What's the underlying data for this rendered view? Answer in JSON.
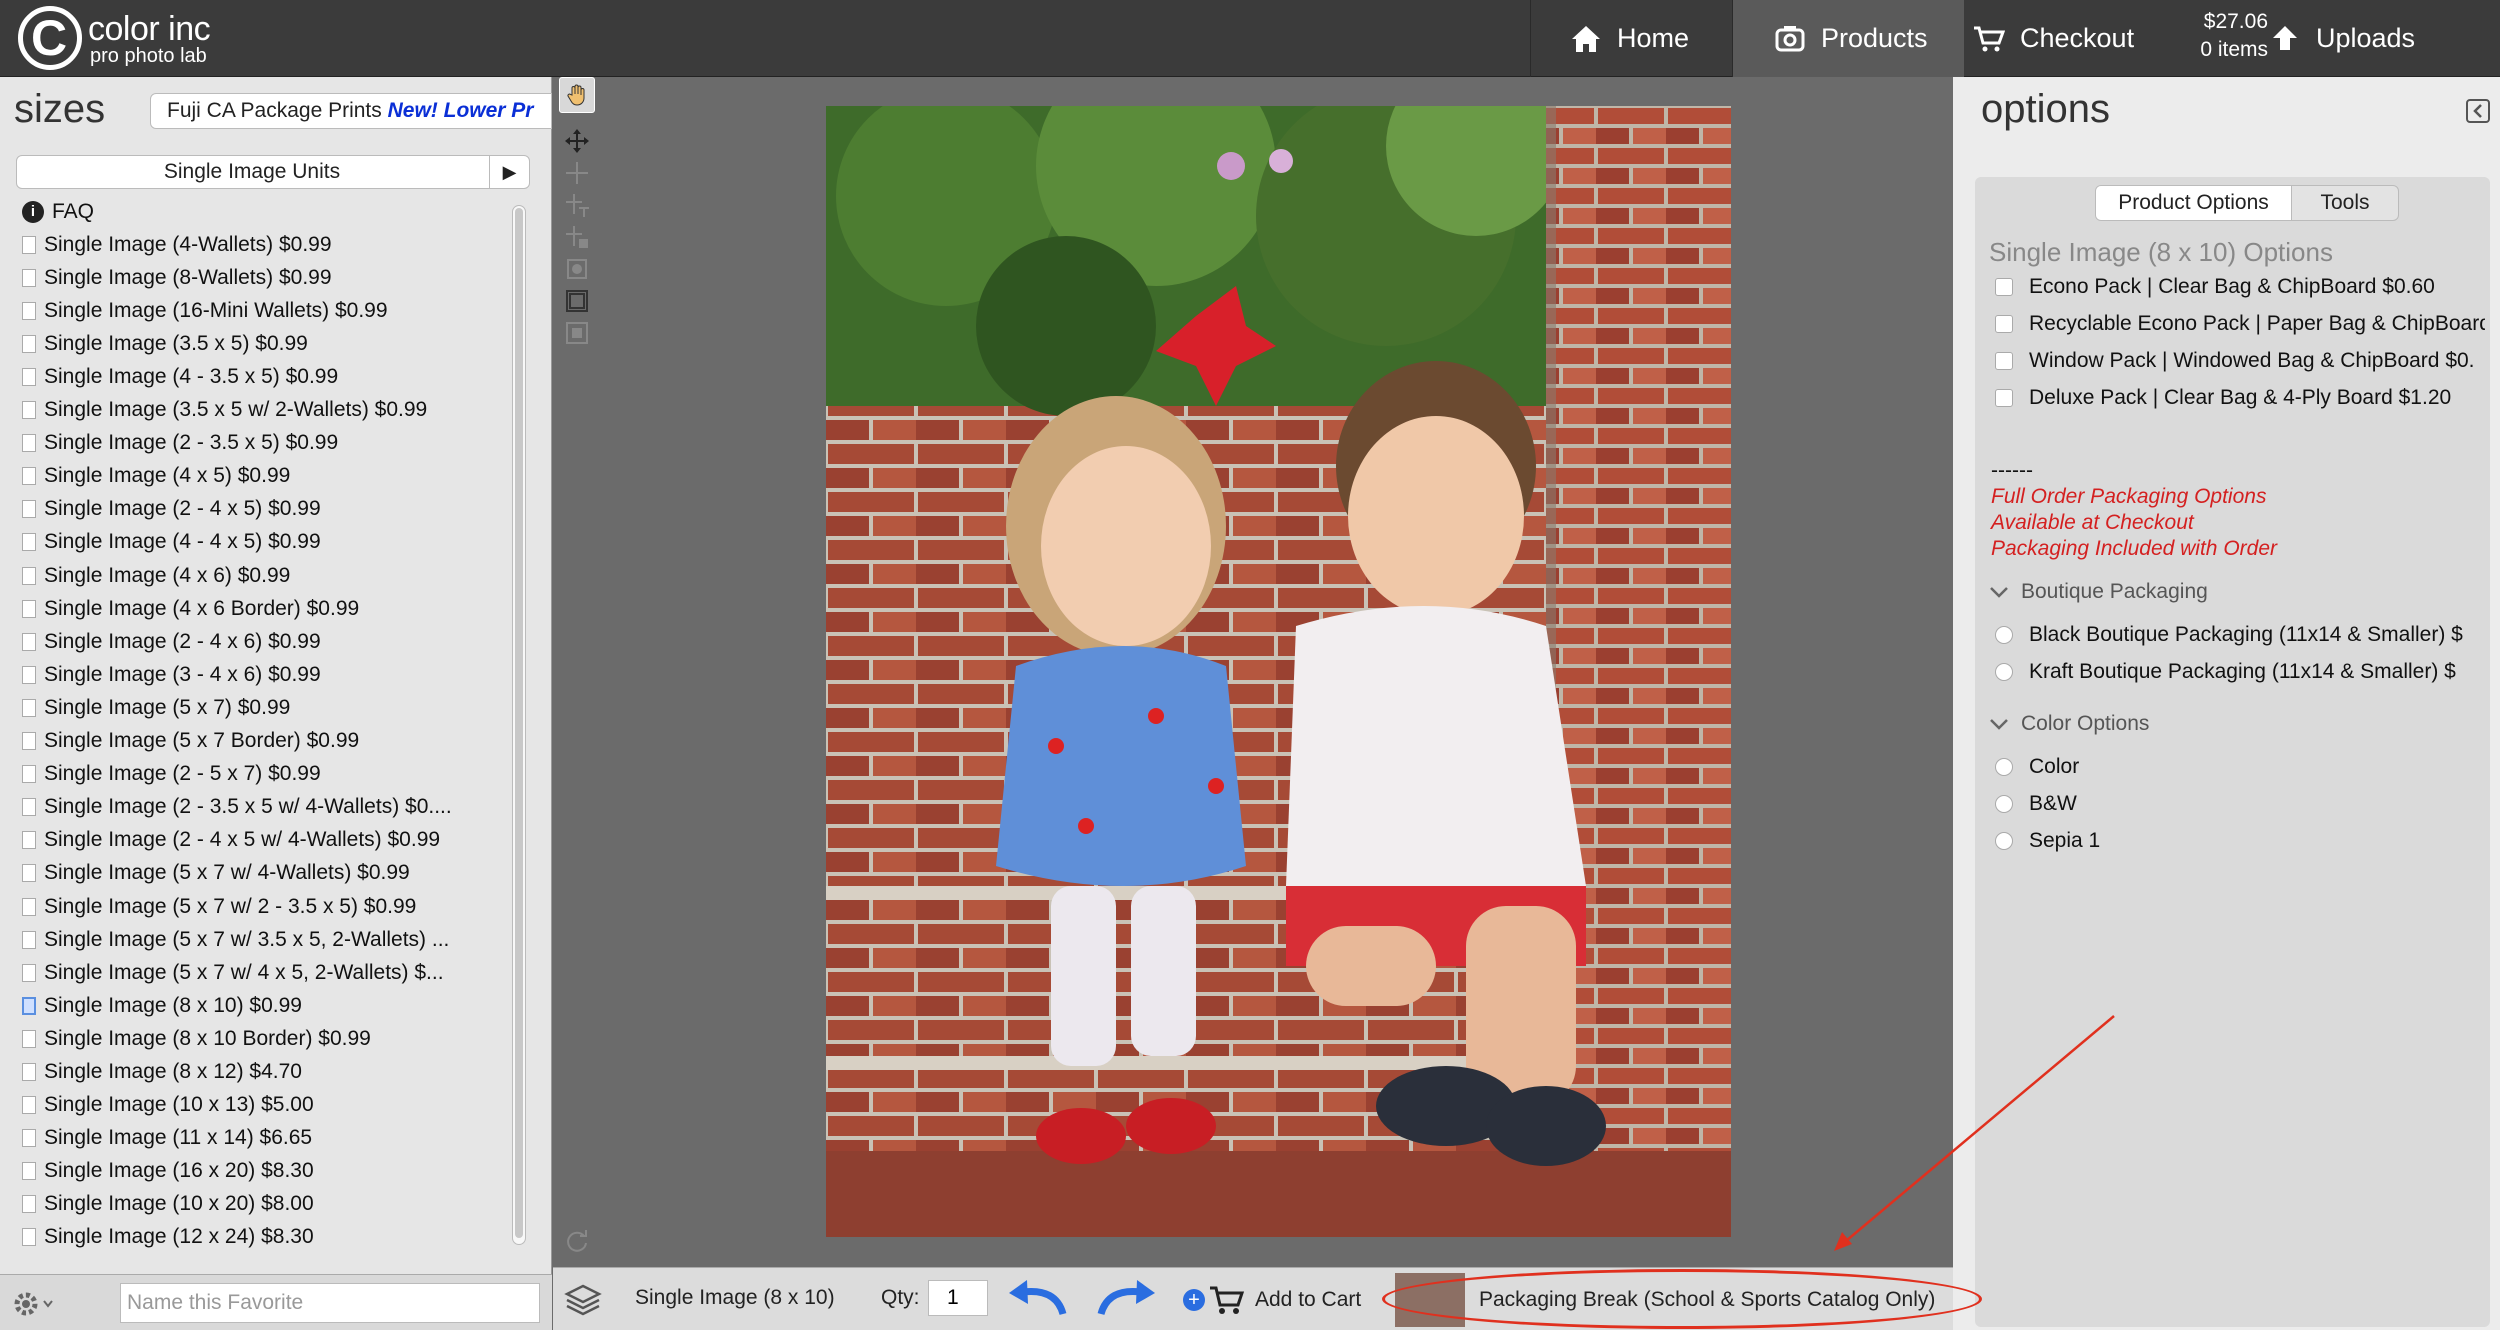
{
  "header": {
    "logo_main": "color inc",
    "logo_sub": "pro photo lab",
    "logo_letter": "C",
    "nav": {
      "home": "Home",
      "products": "Products",
      "checkout": "Checkout",
      "uploads": "Uploads"
    },
    "cart_total": "$27.06",
    "cart_items": "0 items"
  },
  "sizes_panel": {
    "title": "sizes",
    "catalog_name": "Fuji CA Package Prints",
    "catalog_badge": "New! Lower Pr",
    "units_label": "Single Image Units",
    "faq": "FAQ",
    "items": [
      "Single Image (4-Wallets) $0.99",
      "Single Image (8-Wallets) $0.99",
      "Single Image (16-Mini Wallets) $0.99",
      "Single Image (3.5 x 5) $0.99",
      "Single Image (4 - 3.5 x 5) $0.99",
      "Single Image (3.5 x 5 w/ 2-Wallets) $0.99",
      "Single Image (2 - 3.5 x 5) $0.99",
      "Single Image (4 x 5) $0.99",
      "Single Image (2 - 4 x 5) $0.99",
      "Single Image (4 - 4 x 5) $0.99",
      "Single Image (4 x 6) $0.99",
      "Single Image (4 x 6 Border) $0.99",
      "Single Image (2 - 4 x 6) $0.99",
      "Single Image (3 - 4 x 6) $0.99",
      "Single Image (5 x 7) $0.99",
      "Single Image (5 x 7 Border) $0.99",
      "Single Image (2 - 5 x 7) $0.99",
      "Single Image (2 - 3.5 x 5 w/ 4-Wallets) $0....",
      "Single Image (2 - 4 x 5 w/ 4-Wallets) $0.99",
      "Single Image (5 x 7 w/ 4-Wallets) $0.99",
      "Single Image (5 x 7 w/ 2 - 3.5 x 5) $0.99",
      "Single Image (5 x 7 w/ 3.5 x 5, 2-Wallets) ...",
      "Single Image (5 x 7 w/ 4 x 5, 2-Wallets) $...",
      "Single Image (8 x 10) $0.99",
      "Single Image (8 x 10 Border) $0.99",
      "Single Image (8 x 12) $4.70",
      "Single Image (10 x 13) $5.00",
      "Single Image (11 x 14) $6.65",
      "Single Image (16 x 20) $8.30",
      "Single Image (10 x 20) $8.00",
      "Single Image (12 x 24) $8.30"
    ],
    "selected_index": 23,
    "favorite_placeholder": "Name this Favorite"
  },
  "options_panel": {
    "title": "options",
    "tabs": [
      "Product Options",
      "Tools"
    ],
    "heading": "Single Image (8 x 10) Options",
    "packs": [
      "Econo Pack | Clear Bag & ChipBoard $0.60",
      "Recyclable Econo Pack | Paper Bag & ChipBoard",
      "Window Pack | Windowed Bag & ChipBoard $0.",
      "Deluxe Pack | Clear Bag & 4-Ply  Board $1.20"
    ],
    "separator": "------",
    "notes": [
      "Full Order Packaging Options",
      "Available at Checkout",
      "Packaging Included with Order"
    ],
    "boutique_title": "Boutique Packaging",
    "boutique": [
      "Black Boutique Packaging  (11x14 & Smaller) $",
      "Kraft Boutique Packaging  (11x14 & Smaller) $"
    ],
    "color_title": "Color Options",
    "colors": [
      "Color",
      "B&W",
      "Sepia 1"
    ]
  },
  "bottom_bar": {
    "product": "Single Image (8 x 10)",
    "qty_label": "Qty:",
    "qty_value": "1",
    "add_to_cart": "Add to Cart",
    "packaging_break": "Packaging Break (School & Sports Catalog Only)"
  },
  "colors": {
    "topbar": "#3b3b3b",
    "accent_blue": "#2a6de0",
    "note_red": "#d42020",
    "annotation_red": "#e0301e"
  }
}
